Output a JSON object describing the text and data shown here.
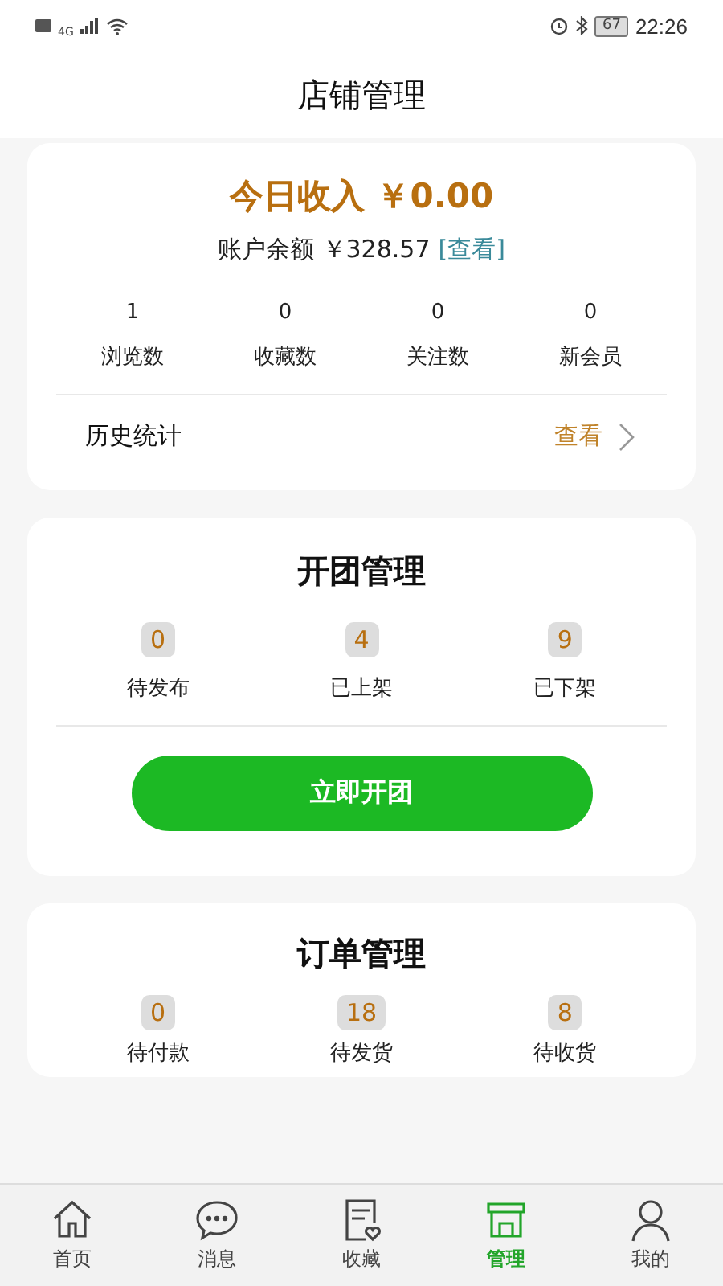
{
  "status_bar": {
    "network": "4G",
    "battery": "67",
    "time": "22:26"
  },
  "header": {
    "title": "店铺管理"
  },
  "income_card": {
    "today_label": "今日收入",
    "today_value": "￥0.00",
    "balance_label": "账户余额",
    "balance_value": "￥328.57",
    "balance_link": "[查看]",
    "stats": [
      {
        "value": "1",
        "label": "浏览数"
      },
      {
        "value": "0",
        "label": "收藏数"
      },
      {
        "value": "0",
        "label": "关注数"
      },
      {
        "value": "0",
        "label": "新会员"
      }
    ],
    "history": {
      "label": "历史统计",
      "link": "查看"
    }
  },
  "group_card": {
    "title": "开团管理",
    "counts": [
      {
        "value": "0",
        "label": "待发布"
      },
      {
        "value": "4",
        "label": "已上架"
      },
      {
        "value": "9",
        "label": "已下架"
      }
    ],
    "button": "立即开团"
  },
  "order_card": {
    "title": "订单管理",
    "counts": [
      {
        "value": "0",
        "label": "待付款"
      },
      {
        "value": "18",
        "label": "待发货"
      },
      {
        "value": "8",
        "label": "待收货"
      }
    ]
  },
  "tab_bar": [
    {
      "label": "首页",
      "selected": false
    },
    {
      "label": "消息",
      "selected": false
    },
    {
      "label": "收藏",
      "selected": false
    },
    {
      "label": "管理",
      "selected": true
    },
    {
      "label": "我的",
      "selected": false
    }
  ]
}
